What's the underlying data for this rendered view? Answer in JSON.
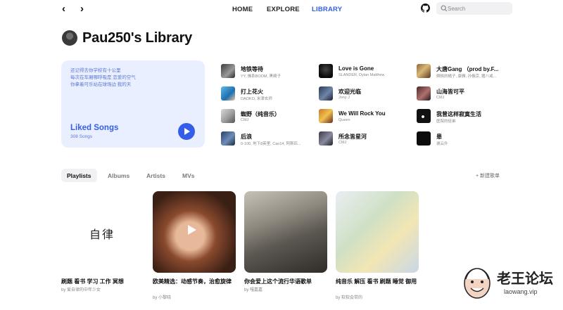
{
  "nav": {
    "back": "‹",
    "forward": "›",
    "links": [
      "HOME",
      "EXPLORE",
      "LIBRARY"
    ],
    "active": "LIBRARY",
    "search_placeholder": "Search"
  },
  "header": {
    "title": "Pau250's Library"
  },
  "liked_songs": {
    "lyrics": [
      "还记得去你学校有十公里",
      "每次在车厢哪呼吸是 恋爱的空气",
      "你拿着可乐站在球场边 我的天"
    ],
    "title": "Liked Songs",
    "count": "308 Songs"
  },
  "songs": [
    {
      "title": "地铁等待",
      "artist": "YY, 佛系BOOM, 黑崎子"
    },
    {
      "title": "Love is Gone",
      "artist": "SLANDER, Dylan Matthew"
    },
    {
      "title": "大唐Gang （prod by.F...",
      "artist": "倒桃的橘子, 康雅, 孙俄京, 猪八戒..."
    },
    {
      "title": "打上花火",
      "artist": "DAOKO, 米津玄师"
    },
    {
      "title": "欢迎光临",
      "artist": "Jony J"
    },
    {
      "title": "山海皆可平",
      "artist": "CMJ"
    },
    {
      "title": "蜘野（纯音乐）",
      "artist": "CMJ"
    },
    {
      "title": "We Will Rock You",
      "artist": "Queen"
    },
    {
      "title": "我曾这样寂寞生活",
      "artist": "医院的徒弟"
    },
    {
      "title": "后浪",
      "artist": "0-100, 地下8英里, Cao14, 阿斯匹..."
    },
    {
      "title": "所念皆星河",
      "artist": "CMJ"
    },
    {
      "title": "患",
      "artist": "谢云升"
    }
  ],
  "tabs": [
    "Playlists",
    "Albums",
    "Artists",
    "MVs"
  ],
  "active_tab": "Playlists",
  "new_playlist": "+ 新建歌单",
  "playlists": [
    {
      "name": "刷题 看书 学习 工作 冥想",
      "owner": "by 爱自律的中年少女",
      "cover_text": "自律"
    },
    {
      "name": "欧美精选：动感节奏，治愈旋律",
      "owner": "by 小黎晓"
    },
    {
      "name": "你会爱上这个流行华语歌单",
      "owner": "by 嘎嘉嘉"
    },
    {
      "name": "纯音乐 解压 看书 刷题 睡觉 御用",
      "owner": "by 软软会带的"
    }
  ],
  "watermark": {
    "brand": "老王论坛",
    "url": "laowang.vip"
  },
  "colors": {
    "accent": "#335eea",
    "card_bg": "#eaefff",
    "tab_bg": "#f1f1f3"
  }
}
